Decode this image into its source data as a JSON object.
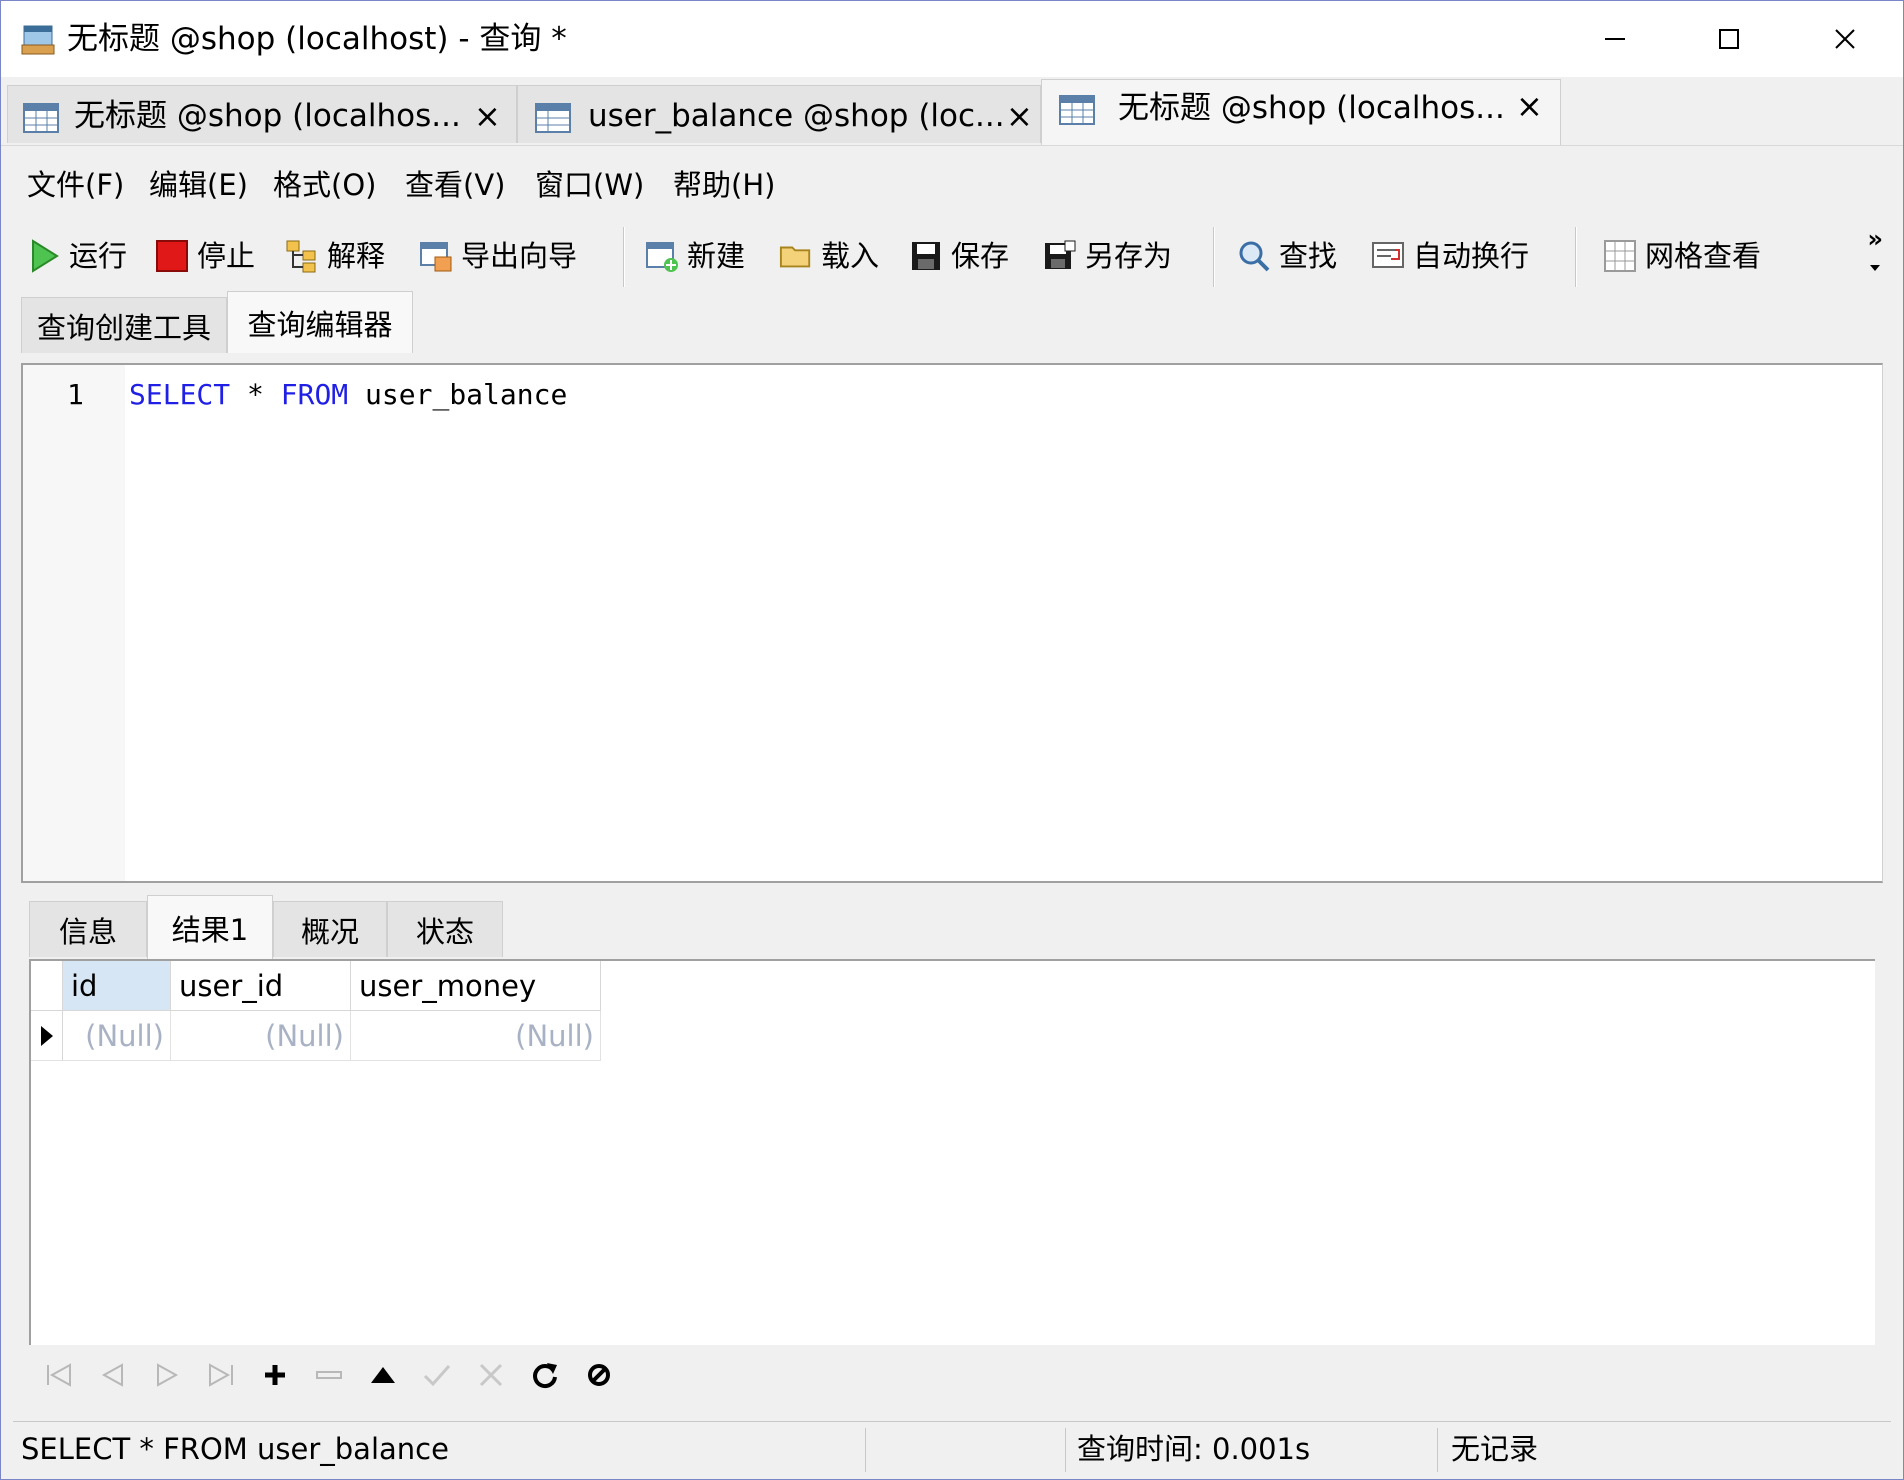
{
  "window": {
    "title": "无标题 @shop (localhost) - 查询 *",
    "controls": [
      "minimize",
      "maximize",
      "close"
    ]
  },
  "doc_tabs": [
    {
      "label": "无标题 @shop (localhos...",
      "close": "×",
      "active": false
    },
    {
      "label": "user_balance @shop (loc...",
      "close": "×",
      "active": false
    },
    {
      "label": "无标题 @shop (localhos...",
      "close": "×",
      "active": true
    }
  ],
  "menu": [
    "文件(F)",
    "编辑(E)",
    "格式(O)",
    "查看(V)",
    "窗口(W)",
    "帮助(H)"
  ],
  "toolbar": {
    "run": "运行",
    "stop": "停止",
    "explain": "解释",
    "export_wizard": "导出向导",
    "new": "新建",
    "load": "载入",
    "save": "保存",
    "save_as": "另存为",
    "find": "查找",
    "word_wrap": "自动换行",
    "grid_view": "网格查看",
    "overflow": "»"
  },
  "editor_tabs": [
    "查询创建工具",
    "查询编辑器"
  ],
  "editor": {
    "line_number": "1",
    "tokens": [
      "SELECT",
      " * ",
      "FROM",
      " user_balance"
    ]
  },
  "result_tabs": [
    "信息",
    "结果1",
    "概况",
    "状态"
  ],
  "grid": {
    "columns": [
      "id",
      "user_id",
      "user_money"
    ],
    "rows": [
      [
        "(Null)",
        "(Null)",
        "(Null)"
      ]
    ]
  },
  "status": {
    "sql": "SELECT * FROM user_balance",
    "query_time": "查询时间: 0.001s",
    "records": "无记录"
  },
  "colors": {
    "keyword": "#1f1fe6",
    "selected_header": "#d6e6f5",
    "null_text": "#a8b2c4",
    "window_border": "#7b86c9"
  }
}
